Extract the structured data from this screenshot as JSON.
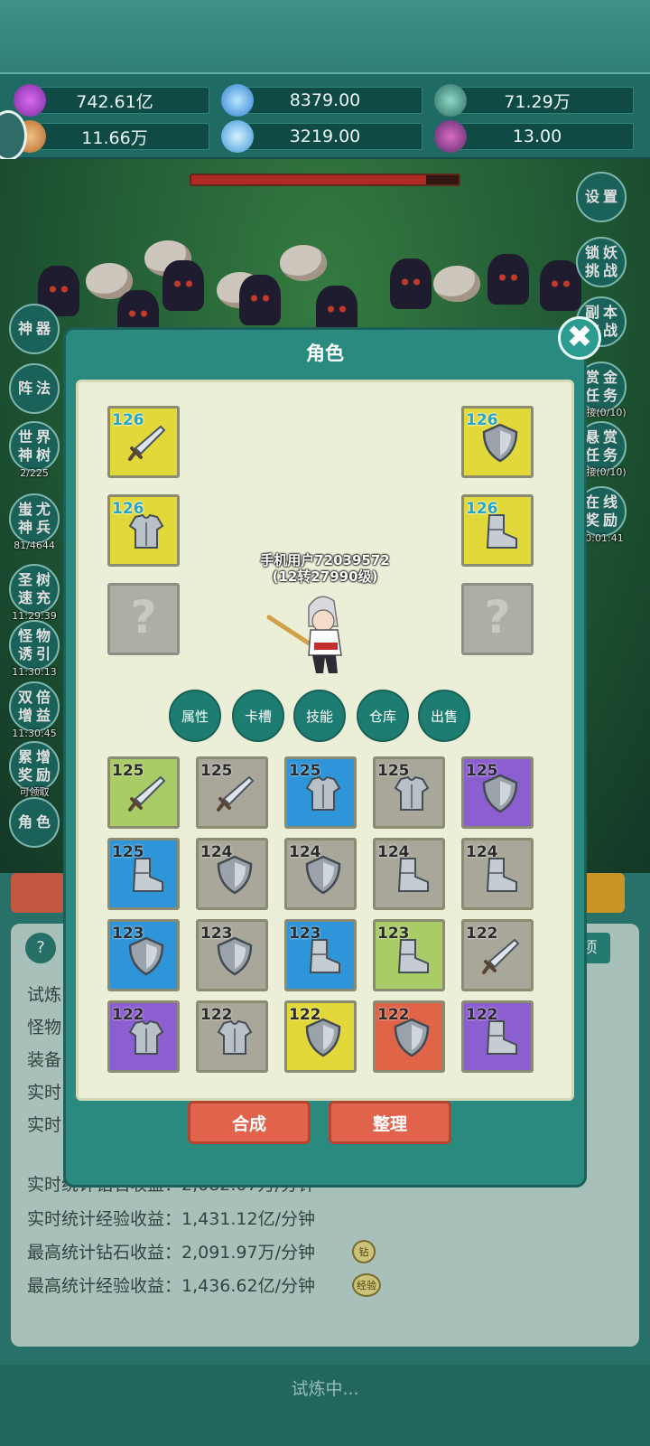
{
  "resources": [
    {
      "icon": "purple-diamond-icon",
      "value": "742.61亿"
    },
    {
      "icon": "blue-crystal-icon",
      "value": "8379.00"
    },
    {
      "icon": "rune-orb-icon",
      "value": "71.29万"
    },
    {
      "icon": "scroll-icon",
      "value": "11.66万"
    },
    {
      "icon": "ice-crystal-icon",
      "value": "3219.00"
    },
    {
      "icon": "potion-icon",
      "value": "13.00"
    }
  ],
  "boss_hp_fraction": 0.88,
  "left_menu": [
    {
      "label": "神器",
      "sub": ""
    },
    {
      "label": "阵法",
      "sub": ""
    },
    {
      "label": "世界神树",
      "sub": "2/225"
    },
    {
      "label": "蚩尤神兵",
      "sub": "81/4644"
    },
    {
      "label": "圣树速充",
      "sub": "11:29:39"
    },
    {
      "label": "怪物诱引",
      "sub": "11:30:13"
    },
    {
      "label": "双倍增益",
      "sub": "11:30:45"
    },
    {
      "label": "累增奖励",
      "sub": "可领取"
    },
    {
      "label": "角色",
      "sub": ""
    }
  ],
  "right_menu": [
    {
      "label": "设置",
      "sub": ""
    },
    {
      "label": "锁妖挑战",
      "sub": ""
    },
    {
      "label": "副本挑战",
      "sub": ""
    },
    {
      "label": "赏金任务",
      "sub": "可接(0/10)"
    },
    {
      "label": "悬赏任务",
      "sub": "可接(0/10)"
    },
    {
      "label": "在线奖励",
      "sub": "00:01:41"
    }
  ],
  "bottom": {
    "help_icon": "?",
    "partial_labels": [
      "试炼",
      "怪物",
      "装备",
      "实时",
      "实时"
    ],
    "right_tab_fragment": "项",
    "stats": [
      {
        "text": "实时统计钻石收益：2,082.07万/分钟",
        "badge": ""
      },
      {
        "text": "实时统计经验收益：1,431.12亿/分钟",
        "badge": ""
      },
      {
        "text": "最高统计钻石收益：2,091.97万/分钟",
        "badge": "钻"
      },
      {
        "text": "最高统计经验收益：1,436.62亿/分钟",
        "badge": "经验"
      }
    ],
    "status": "试炼中..."
  },
  "modal": {
    "title": "角色",
    "close": "✖",
    "player_name": "手机用户72039572",
    "player_level": "(12转27990级)",
    "equipped": [
      {
        "level": "126",
        "item": "sword"
      },
      {
        "level": "126",
        "item": "shield"
      },
      {
        "level": "126",
        "item": "armor"
      },
      {
        "level": "126",
        "item": "boots"
      },
      {
        "level": "",
        "item": "empty",
        "glyph": "?"
      },
      {
        "level": "",
        "item": "empty",
        "glyph": "?"
      }
    ],
    "tabs": [
      "属性",
      "卡槽",
      "技能",
      "仓库",
      "出售"
    ],
    "inventory": [
      {
        "level": "125",
        "item": "sword",
        "rarity": "green"
      },
      {
        "level": "125",
        "item": "sword",
        "rarity": "gray"
      },
      {
        "level": "125",
        "item": "armor",
        "rarity": "blue"
      },
      {
        "level": "125",
        "item": "armor",
        "rarity": "gray"
      },
      {
        "level": "125",
        "item": "shield",
        "rarity": "purple"
      },
      {
        "level": "125",
        "item": "boots",
        "rarity": "blue"
      },
      {
        "level": "124",
        "item": "shield",
        "rarity": "gray"
      },
      {
        "level": "124",
        "item": "shield",
        "rarity": "gray"
      },
      {
        "level": "124",
        "item": "boots",
        "rarity": "gray"
      },
      {
        "level": "124",
        "item": "boots",
        "rarity": "gray"
      },
      {
        "level": "123",
        "item": "shield",
        "rarity": "blue"
      },
      {
        "level": "123",
        "item": "shield",
        "rarity": "gray"
      },
      {
        "level": "123",
        "item": "boots",
        "rarity": "blue"
      },
      {
        "level": "123",
        "item": "boots",
        "rarity": "green"
      },
      {
        "level": "122",
        "item": "sword",
        "rarity": "gray"
      },
      {
        "level": "122",
        "item": "armor",
        "rarity": "purple"
      },
      {
        "level": "122",
        "item": "armor",
        "rarity": "gray"
      },
      {
        "level": "122",
        "item": "shield",
        "rarity": "yellow"
      },
      {
        "level": "122",
        "item": "shield",
        "rarity": "red"
      },
      {
        "level": "122",
        "item": "boots",
        "rarity": "purple"
      }
    ],
    "buttons": {
      "synthesize": "合成",
      "sort": "整理"
    }
  }
}
